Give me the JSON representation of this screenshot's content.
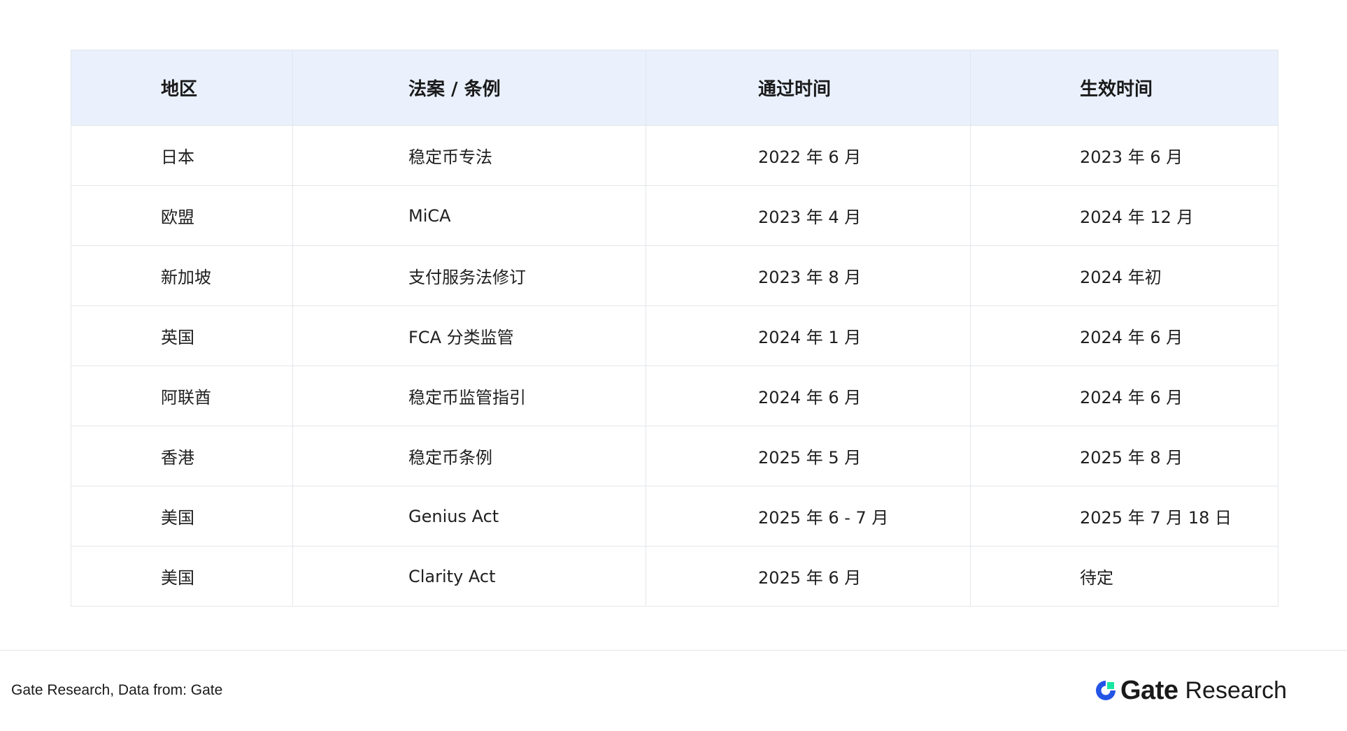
{
  "table": {
    "headers": [
      "地区",
      "法案 / 条例",
      "通过时间",
      "生效时间"
    ],
    "rows": [
      [
        "日本",
        "稳定币专法",
        "2022 年 6 月",
        "2023 年 6 月"
      ],
      [
        "欧盟",
        "MiCA",
        "2023 年 4 月",
        "2024 年 12 月"
      ],
      [
        "新加坡",
        "支付服务法修订",
        "2023 年 8 月",
        "2024 年初"
      ],
      [
        "英国",
        "FCA 分类监管",
        "2024 年 1 月",
        "2024 年 6 月"
      ],
      [
        "阿联酋",
        "稳定币监管指引",
        "2024 年 6 月",
        "2024 年 6 月"
      ],
      [
        "香港",
        "稳定币条例",
        "2025 年 5 月",
        "2025 年 8 月"
      ],
      [
        "美国",
        "Genius Act",
        "2025 年 6 - 7 月",
        "2025 年 7 月 18 日"
      ],
      [
        "美国",
        "Clarity Act",
        "2025 年 6 月",
        "待定"
      ]
    ]
  },
  "footer": {
    "source": "Gate Research, Data from:  Gate",
    "brand_name": "Gate",
    "brand_suffix": "Research",
    "brand_icon": "gate-logo-icon",
    "brand_colors": {
      "blue": "#2354e6",
      "green": "#17e6a1"
    }
  },
  "colors": {
    "header_bg": "#eaf1fd",
    "border": "#e3e6ea",
    "text": "#1f1f1f"
  }
}
